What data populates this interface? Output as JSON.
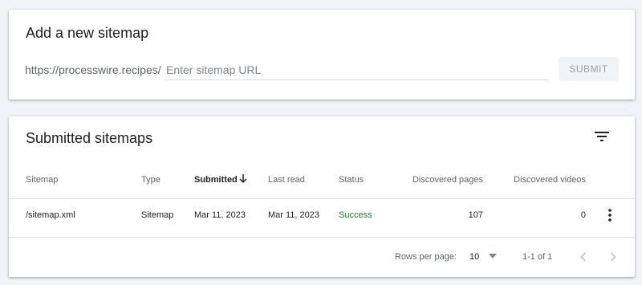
{
  "add_sitemap": {
    "title": "Add a new sitemap",
    "url_prefix": "https://processwire.recipes/",
    "input_value": "",
    "input_placeholder": "Enter sitemap URL",
    "submit_label": "SUBMIT"
  },
  "submitted": {
    "title": "Submitted sitemaps",
    "filter_icon": "filter-list-icon",
    "columns": [
      "Sitemap",
      "Type",
      "Submitted",
      "Last read",
      "Status",
      "Discovered pages",
      "Discovered videos"
    ],
    "sort_column": "Submitted",
    "sort_direction": "descending",
    "sort_icon": "arrow-down-icon",
    "rows": [
      {
        "sitemap": "/sitemap.xml",
        "type": "Sitemap",
        "submitted": "Mar 11, 2023",
        "last_read": "Mar 11, 2023",
        "status": "Success",
        "discovered_pages": "107",
        "discovered_videos": "0"
      }
    ],
    "more_icon": "more-vert-icon",
    "status_color": "#188038",
    "footer": {
      "rows_per_page_label": "Rows per page:",
      "rows_per_page_value": "10",
      "range": "1-1 of 1",
      "prev_icon": "chevron-left-icon",
      "next_icon": "chevron-right-icon"
    }
  }
}
